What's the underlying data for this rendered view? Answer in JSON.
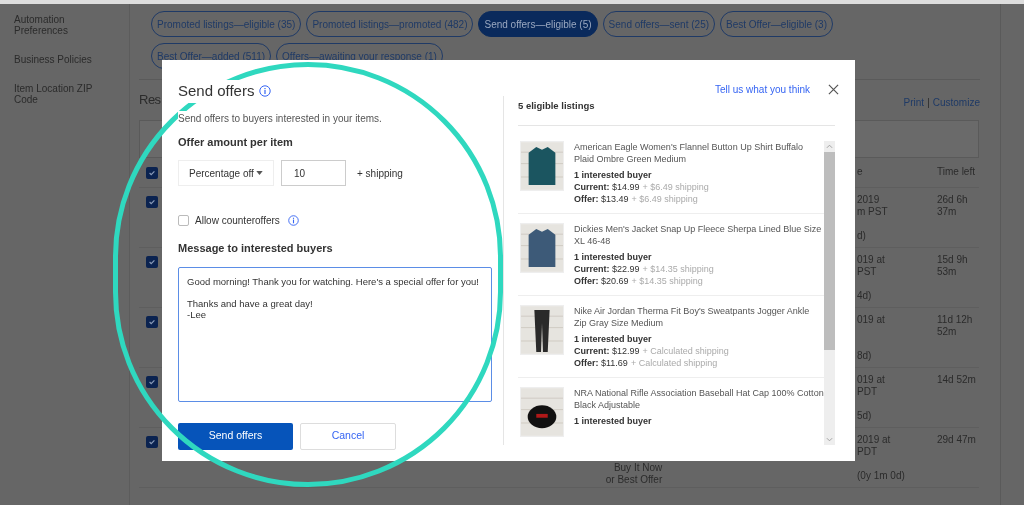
{
  "sidebar": {
    "items": [
      "Automation Preferences",
      "Business Policies",
      "Item Location ZIP Code"
    ]
  },
  "filters": [
    {
      "label": "Promoted listings—eligible (35)",
      "selected": false
    },
    {
      "label": "Promoted listings—promoted (482)",
      "selected": false
    },
    {
      "label": "Send offers—eligible (5)",
      "selected": true
    },
    {
      "label": "Send offers—sent (25)",
      "selected": false
    },
    {
      "label": "Best Offer—eligible (3)",
      "selected": false
    },
    {
      "label": "Best Offer—added (511)",
      "selected": false
    },
    {
      "label": "Offers—awaiting your response (1)",
      "selected": false
    }
  ],
  "heading": "Res",
  "links": [
    "Print",
    "|",
    "Customize"
  ],
  "table": {
    "header": {
      "checked": true,
      "column_a": "e",
      "column_b": "Time left"
    },
    "rows": [
      {
        "checked": true,
        "column_a": "2019\nm PST\n\nd)",
        "column_b": "26d 6h\n37m"
      },
      {
        "checked": true,
        "column_a": "019 at\nPST\n\n4d)",
        "column_b": "15d 9h\n53m"
      },
      {
        "checked": true,
        "column_a": "019 at\n\n\n8d)",
        "column_b": "11d 12h\n52m"
      },
      {
        "checked": true,
        "column_a": "019 at\nPDT\n\n5d)",
        "column_b": "14d 52m"
      },
      {
        "checked": true,
        "column_a": "2019 at\nPDT\n\n(0y 1m 0d)",
        "column_b": "29d 47m",
        "column_c": "Buy It Now\nor Best Offer"
      }
    ]
  },
  "dialog": {
    "title": "Send offers",
    "subtitle": "Send offers to buyers interested in your items.",
    "amount_label": "Offer amount per item",
    "offer_type": "Percentage off",
    "amount": "10",
    "shipping": "+ shipping",
    "counteroffers": {
      "label": "Allow counteroffers",
      "checked": false
    },
    "message_label": "Message to interested buyers",
    "message": "Good morning! Thank you for watching. Here's a special offer for you!\n\nThanks and have a great day!\n-Lee",
    "send_button": "Send offers",
    "cancel_button": "Cancel",
    "feedback_link": "Tell us what you think",
    "listings_title": "5 eligible listings",
    "listings": [
      {
        "title": "American Eagle Women's Flannel Button Up Shirt Buffalo Plaid Ombre Green Medium",
        "buyers": "1 interested buyer",
        "current": "**Current:** $14.99",
        "current_shipping": "+ $6.49 shipping",
        "offer": "**Offer:** $13.49",
        "offer_shipping": "+ $6.49 shipping"
      },
      {
        "title": "Dickies Men's Jacket Snap Up Fleece Sherpa Lined Blue Size XL 46-48",
        "buyers": "1 interested buyer",
        "current": "**Current:** $22.99",
        "current_shipping": "+ $14.35 shipping",
        "offer": "**Offer:** $20.69",
        "offer_shipping": "+ $14.35 shipping"
      },
      {
        "title": "Nike Air Jordan Therma Fit Boy's Sweatpants Jogger Ankle Zip Gray Size Medium",
        "buyers": "1 interested buyer",
        "current": "**Current:** $12.99",
        "current_shipping": "+ Calculated shipping",
        "offer": "**Offer:** $11.69",
        "offer_shipping": "+ Calculated shipping"
      },
      {
        "title": "NRA National Rifle Association Baseball Hat Cap 100% Cotton Black Adjustable",
        "buyers": "1 interested buyer"
      }
    ]
  }
}
